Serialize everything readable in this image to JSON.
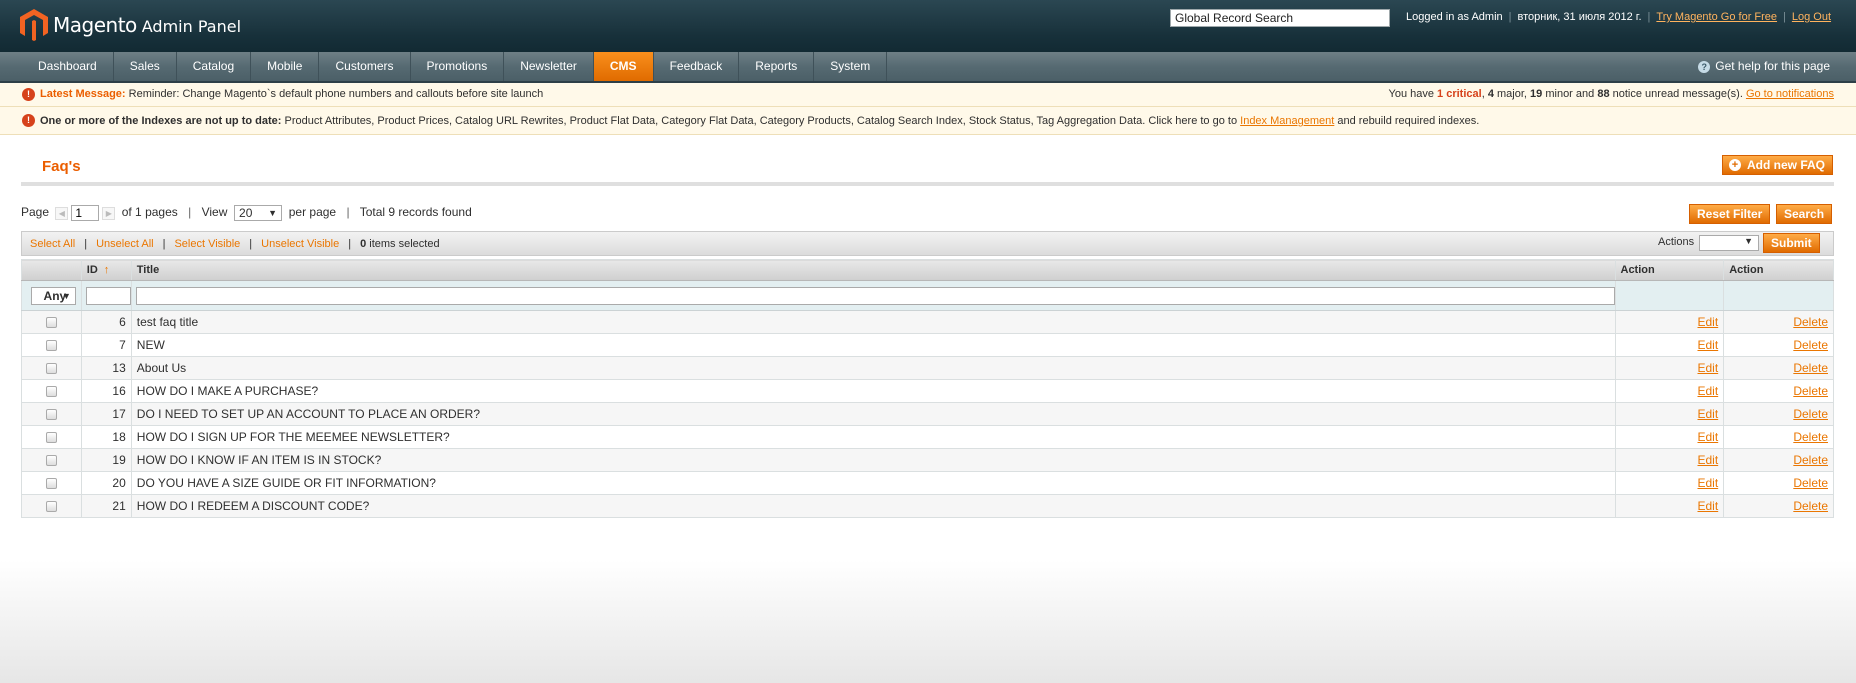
{
  "header": {
    "logo_text": "Magento",
    "logo_sub": "Admin Panel",
    "search_value": "Global Record Search",
    "logged_in": "Logged in as Admin",
    "date": "вторник, 31 июля 2012 г.",
    "try_link": "Try Magento Go for Free",
    "logout": "Log Out"
  },
  "nav": {
    "items": [
      "Dashboard",
      "Sales",
      "Catalog",
      "Mobile",
      "Customers",
      "Promotions",
      "Newsletter",
      "CMS",
      "Feedback",
      "Reports",
      "System"
    ],
    "active": "CMS",
    "help": "Get help for this page"
  },
  "notices": {
    "latest_label": "Latest Message:",
    "latest_text": "Reminder: Change Magento`s default phone numbers and callouts before site launch",
    "summary_prefix": "You have",
    "critical": "1 critical",
    "major_count": "4",
    "major_label": "major,",
    "minor_count": "19",
    "minor_label": "minor and",
    "notice_count": "88",
    "notice_label": "notice unread message(s).",
    "go_link": "Go to notifications",
    "index_label": "One or more of the Indexes are not up to date:",
    "index_text": "Product Attributes, Product Prices, Catalog URL Rewrites, Product Flat Data, Category Flat Data, Category Products, Catalog Search Index, Stock Status, Tag Aggregation Data. Click here to go to",
    "index_link": "Index Management",
    "index_suffix": "and rebuild required indexes."
  },
  "page": {
    "title": "Faq's",
    "add_button": "Add new FAQ",
    "reset_filter": "Reset Filter",
    "search": "Search"
  },
  "pager": {
    "page_label": "Page",
    "page_value": "1",
    "of_pages": "of 1 pages",
    "view_label": "View",
    "per_page_value": "20",
    "per_page_label": "per page",
    "total": "Total 9 records found"
  },
  "massaction": {
    "select_all": "Select All",
    "unselect_all": "Unselect All",
    "select_visible": "Select Visible",
    "unselect_visible": "Unselect Visible",
    "selected_count": "0",
    "selected_label": "items selected",
    "actions_label": "Actions",
    "submit": "Submit"
  },
  "grid": {
    "columns": [
      "ID",
      "Title",
      "Action",
      "Action"
    ],
    "sort_indicator": "↑",
    "filter_any": "Any",
    "rows": [
      {
        "id": "6",
        "title": "test faq title",
        "edit": "Edit",
        "delete": "Delete"
      },
      {
        "id": "7",
        "title": "NEW",
        "edit": "Edit",
        "delete": "Delete"
      },
      {
        "id": "13",
        "title": "About Us",
        "edit": "Edit",
        "delete": "Delete"
      },
      {
        "id": "16",
        "title": "HOW DO I MAKE A PURCHASE?",
        "edit": "Edit",
        "delete": "Delete"
      },
      {
        "id": "17",
        "title": "DO I NEED TO SET UP AN ACCOUNT TO PLACE AN ORDER?",
        "edit": "Edit",
        "delete": "Delete"
      },
      {
        "id": "18",
        "title": "HOW DO I SIGN UP FOR THE MEEMEE NEWSLETTER?",
        "edit": "Edit",
        "delete": "Delete"
      },
      {
        "id": "19",
        "title": "HOW DO I KNOW IF AN ITEM IS IN STOCK?",
        "edit": "Edit",
        "delete": "Delete"
      },
      {
        "id": "20",
        "title": "DO YOU HAVE A SIZE GUIDE OR FIT INFORMATION?",
        "edit": "Edit",
        "delete": "Delete"
      },
      {
        "id": "21",
        "title": "HOW DO I REDEEM A DISCOUNT CODE?",
        "edit": "Edit",
        "delete": "Delete"
      }
    ]
  },
  "colors": {
    "accent": "#eb5e00",
    "link": "#ea7601",
    "header_bg": "#17303a",
    "nav_bg": "#566a72",
    "notice_bg": "#fff9e9"
  }
}
